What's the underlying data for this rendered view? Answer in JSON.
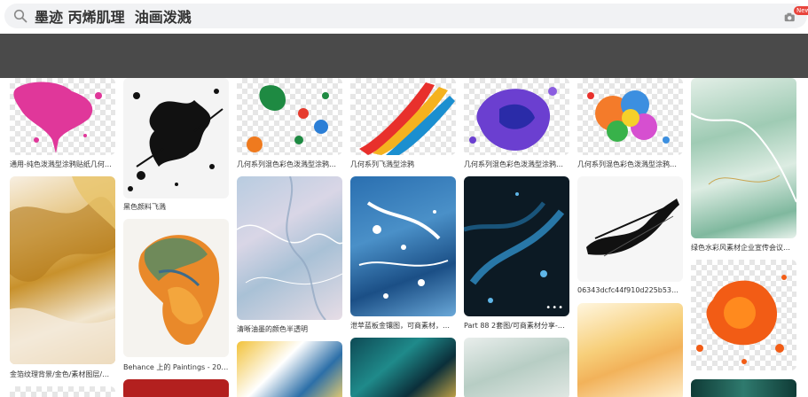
{
  "search": {
    "query": "墨迹 丙烯肌理  油画泼溅",
    "new_badge": "New"
  },
  "results": [
    {
      "caption": "通用-纯色泼溅型涂鸦贴纸几何系列"
    },
    {
      "caption": "黑色颜料飞溅"
    },
    {
      "caption": "几何系列混色彩色泼溅型涂鸦贴纸"
    },
    {
      "caption": "几何系列飞溅型涂鸦"
    },
    {
      "caption": "几何系列混色彩色泼溅型涂鸦贴纸"
    },
    {
      "caption": "几何系列混色彩色泼溅型涂鸦贴纸"
    },
    {
      "caption": "绿色水彩风素材企业宣传会议年会..."
    },
    {
      "caption": "金箔纹理背景/金色/素材图层/♟ - ..."
    },
    {
      "caption": "Behance 上的 Paintings - 2020 Oc..."
    },
    {
      "caption": "清晰油墨的颜色半透明"
    },
    {
      "caption": "泄苹蓝板金镶图，可商素材，畅图..."
    },
    {
      "caption": "Part 88 2套图/可商素材分享-爆居..."
    },
    {
      "caption": "06343dcfc44f910d225b53bef5ec..."
    }
  ],
  "icons": {
    "search": "search-icon",
    "camera": "camera-icon",
    "more": "more-icon"
  }
}
